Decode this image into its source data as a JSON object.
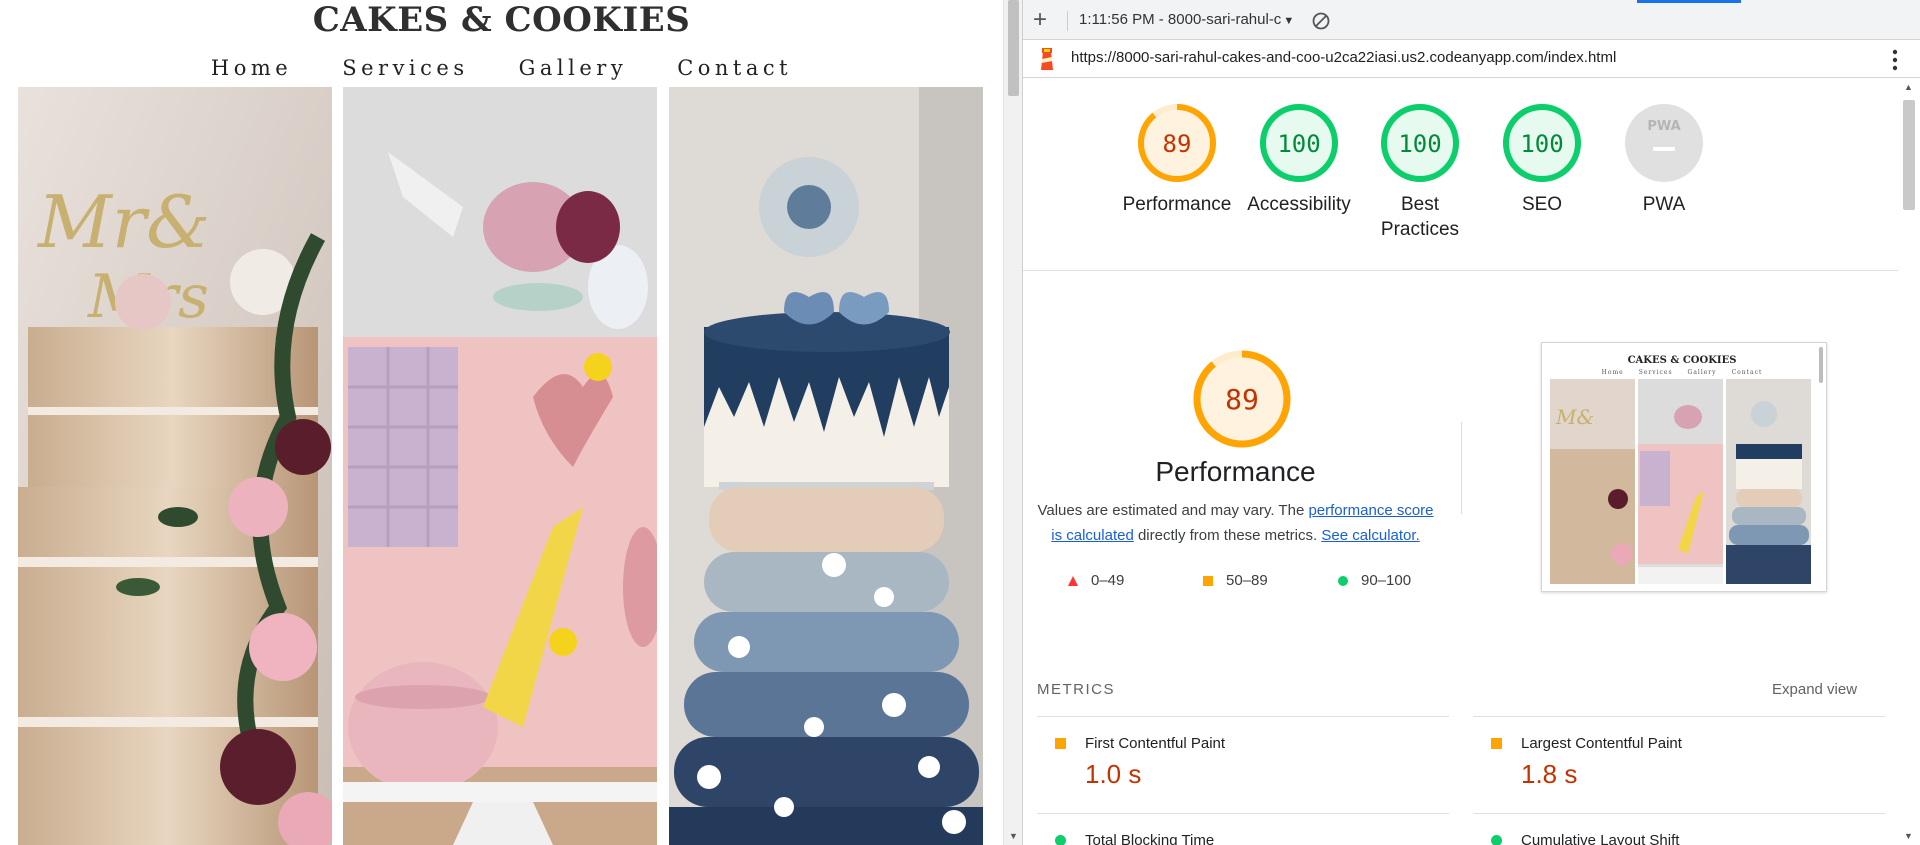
{
  "site": {
    "title": "CAKES & COOKIES",
    "nav": [
      "Home",
      "Services",
      "Gallery",
      "Contact"
    ]
  },
  "devtools": {
    "toolbar": {
      "report_label": "1:11:56 PM - 8000-sari-rahul-c"
    },
    "url": "https://8000-sari-rahul-cakes-and-coo-u2ca22iasi.us2.codeanyapp.com/index.html",
    "gauges": [
      {
        "label": "Performance",
        "score": "89",
        "value": 89,
        "status": "average"
      },
      {
        "label": "Accessibility",
        "score": "100",
        "value": 100,
        "status": "pass"
      },
      {
        "label": "Best Practices",
        "score": "100",
        "value": 100,
        "status": "pass"
      },
      {
        "label": "SEO",
        "score": "100",
        "value": 100,
        "status": "pass"
      },
      {
        "label": "PWA",
        "score": "",
        "value": null,
        "status": "na"
      }
    ],
    "performance": {
      "score": "89",
      "title": "Performance",
      "desc_part1": "Values are estimated and may vary. The ",
      "desc_link1": "performance score is calculated",
      "desc_part2": " directly from these metrics. ",
      "desc_link2": "See calculator."
    },
    "legend": [
      {
        "range": "0–49",
        "shape": "triangle",
        "color": "#ff3333"
      },
      {
        "range": "50–89",
        "shape": "square",
        "color": "#ffa400"
      },
      {
        "range": "90–100",
        "shape": "circle",
        "color": "#0cce6b"
      }
    ],
    "thumbnail": {
      "title": "CAKES & COOKIES",
      "nav": [
        "Home",
        "Services",
        "Gallery",
        "Contact"
      ]
    },
    "metrics_heading": "METRICS",
    "expand_label": "Expand view",
    "metrics": [
      {
        "name": "First Contentful Paint",
        "value": "1.0 s",
        "status": "average"
      },
      {
        "name": "Largest Contentful Paint",
        "value": "1.8 s",
        "status": "average"
      },
      {
        "name": "Total Blocking Time",
        "value": "",
        "status": "pass"
      },
      {
        "name": "Cumulative Layout Shift",
        "value": "",
        "status": "pass"
      }
    ],
    "pwa_badge": "PWA",
    "colors": {
      "pass": "#0cce6b",
      "average": "#ffa400",
      "fail": "#ff3333",
      "na": "#cccccc",
      "link": "#1a5ed8"
    }
  }
}
